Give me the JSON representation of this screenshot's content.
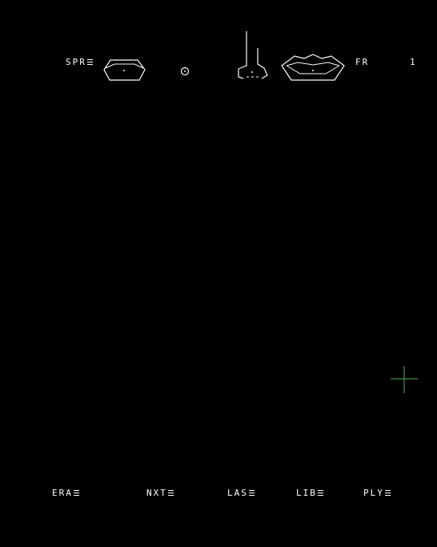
{
  "toolbar": {
    "spr_label": "SPR",
    "frame_label": "FR",
    "frame_number": "1",
    "parts": [
      {
        "icon": "eye-icon"
      },
      {
        "icon": "dot-icon"
      },
      {
        "icon": "nose-icon"
      },
      {
        "icon": "mouth-icon"
      }
    ]
  },
  "menu": {
    "items": [
      {
        "label": "ERA"
      },
      {
        "label": "NXT"
      },
      {
        "label": "LAS"
      },
      {
        "label": "LIB"
      },
      {
        "label": "PLY"
      }
    ]
  },
  "colors": {
    "background": "#000000",
    "foreground": "#ffffff",
    "cursor": "#4caf50"
  },
  "cursor": {
    "icon": "crosshair-icon"
  }
}
